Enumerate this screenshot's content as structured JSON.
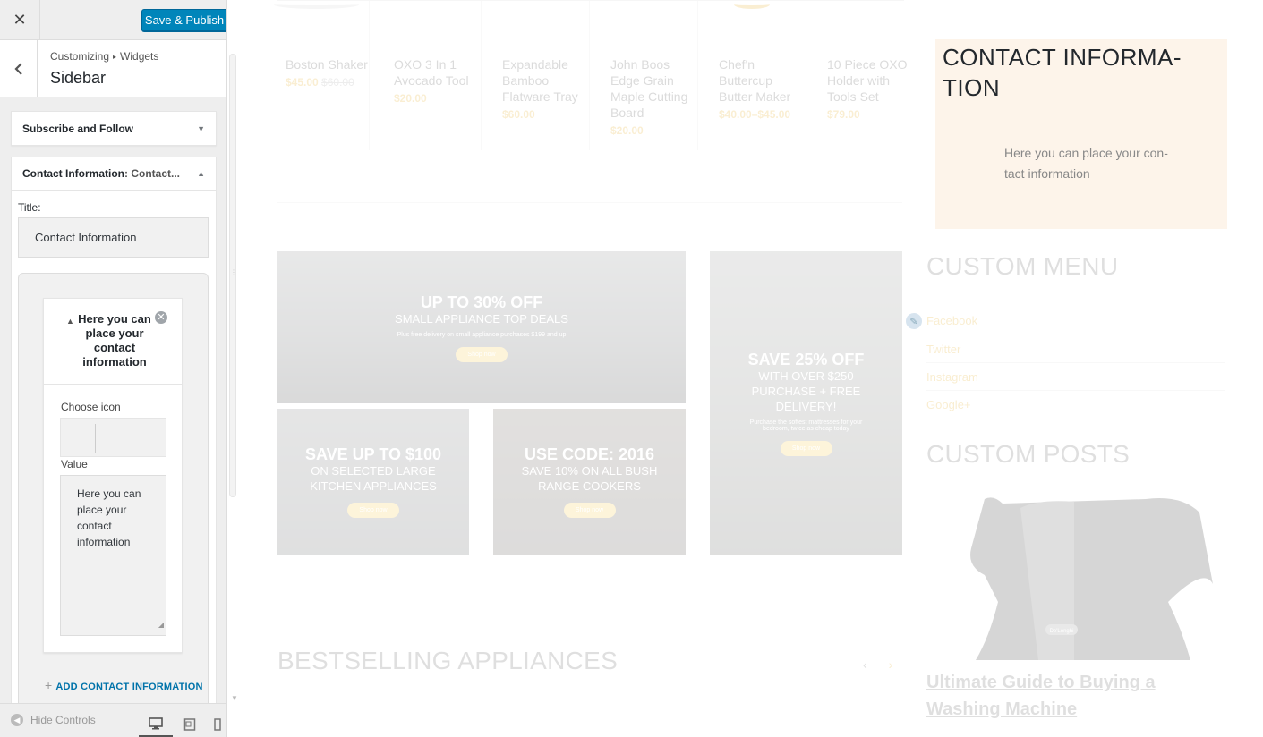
{
  "panel": {
    "close_label": "✕",
    "publish_label": "Save & Publish",
    "breadcrumb_first": "Customizing",
    "breadcrumb_sep": "▸",
    "breadcrumb_second": "Widgets",
    "section_title": "Sidebar"
  },
  "widgets": {
    "subscribe": {
      "label": "Subscribe and Follow"
    },
    "contact": {
      "label": "Contact Information",
      "in_title": ": Contact...",
      "title_field_label": "Title:",
      "title_value": "Contact Information",
      "item": {
        "title": "Here you can place your contact information",
        "choose_icon_label": "Choose icon",
        "value_label": "Value",
        "value_text": "Here you can place your contact information"
      },
      "add_contact": "ADD CONTACT INFORMATION"
    }
  },
  "footer": {
    "hide_controls": "Hide Controls"
  },
  "preview": {
    "products": [
      {
        "name": "Boston Shaker",
        "price": "$45.00",
        "old_price": "$60.00"
      },
      {
        "name": "OXO 3 In 1 Avocado Tool",
        "price": "$20.00",
        "old_price": ""
      },
      {
        "name": "Expandable Bamboo Flatware Tray",
        "price": "$60.00",
        "old_price": ""
      },
      {
        "name": "John Boos Edge Grain Maple Cutting Board",
        "price": "$20.00",
        "old_price": ""
      },
      {
        "name": "Chef'n Buttercup Butter Maker",
        "price": "$40.00–$45.00",
        "old_price": ""
      },
      {
        "name": "10 Piece OXO Holder with Tools Set",
        "price": "$79.00",
        "old_price": ""
      }
    ],
    "banners": {
      "b1": {
        "big": "UP TO 30% OFF",
        "sub": "SMALL APPLIANCE TOP DEALS",
        "small": "Plus free delivery on small appliance purchases $199 and up",
        "btn": "Shop now"
      },
      "b2": {
        "big": "SAVE 25% OFF",
        "sub": "WITH OVER $250 PURCHASE + FREE DELIVERY!",
        "small": "Purchase the softest mattresses for your bedroom, twice as cheap today",
        "btn": "Shop now"
      },
      "b3": {
        "big": "SAVE UP TO $100",
        "sub": "ON SELECTED LARGE KITCHEN APPLIANCES",
        "btn": "Shop now"
      },
      "b4": {
        "big": "USE CODE: 2016",
        "sub": "SAVE 10% ON ALL BUSH RANGE COOKERS",
        "btn": "Shop now"
      }
    },
    "bestselling_heading": "BESTSELLING APPLIANCES",
    "sidebar": {
      "contact_title": "CONTACT INFORMA-TION",
      "contact_text": "Here you can place your con-tact information",
      "custom_menu_heading": "CUSTOM MENU",
      "menu_links": [
        "Facebook",
        "Twitter",
        "Instagram",
        "Google+"
      ],
      "custom_posts_heading": "CUSTOM POSTS",
      "post_title": "Ultimate Guide to Buying a Washing Machine",
      "kettle_brand": "De'Longhi"
    }
  },
  "colors": {
    "primary_button": "#0085ba",
    "accent": "#e0a100",
    "contact_bg": "#fdf4ea",
    "link": "#0073aa"
  }
}
